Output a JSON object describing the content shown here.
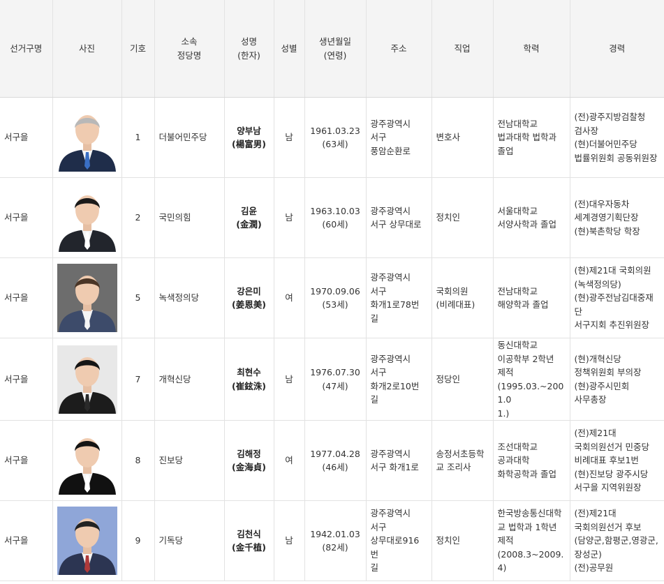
{
  "headers": {
    "district": "선거구명",
    "photo": "사진",
    "number": "기호",
    "party": "소속\n정당명",
    "name": "성명\n(한자)",
    "gender": "성별",
    "birth": "생년월일\n(연령)",
    "address": "주소",
    "job": "직업",
    "education": "학력",
    "career": "경력"
  },
  "rows": [
    {
      "district": "서구을",
      "number": "1",
      "party": "더불어민주당",
      "name": "양부남\n(楊富男)",
      "gender": "남",
      "birth": "1961.03.23\n(63세)",
      "address": "광주광역시\n서구\n풍암순환로",
      "job": "변호사",
      "education": "전남대학교\n법과대학 법학과\n졸업",
      "career": "(전)광주지방검찰청\n검사장\n(현)더불어민주당\n법률위원회 공동위원장",
      "photo_bg": "#ffffff",
      "photo_suit": "#1f2d4a",
      "photo_hair": "#b8b8b8",
      "photo_tie": "#3a6fc4"
    },
    {
      "district": "서구을",
      "number": "2",
      "party": "국민의힘",
      "name": "김윤\n(金潤)",
      "gender": "남",
      "birth": "1963.10.03\n(60세)",
      "address": "광주광역시\n서구 상무대로",
      "job": "정치인",
      "education": "서울대학교\n서양사학과 졸업",
      "career": "(전)대우자동차\n세계경영기획단장\n(현)북촌학당 학장",
      "photo_bg": "#ffffff",
      "photo_suit": "#22252c",
      "photo_hair": "#1a1a1a",
      "photo_tie": "#ffffff"
    },
    {
      "district": "서구을",
      "number": "5",
      "party": "녹색정의당",
      "name": "강은미\n(姜恩美)",
      "gender": "여",
      "birth": "1970.09.06\n(53세)",
      "address": "광주광역시\n서구\n화개1로78번길",
      "job": "국회의원\n(비례대표)",
      "education": "전남대학교\n해양학과 졸업",
      "career": "(현)제21대 국회의원\n(녹색정의당)\n(현)광주전남김대중재단\n서구지회 추진위원장",
      "photo_bg": "#6d6d6d",
      "photo_suit": "#3d4b6a",
      "photo_hair": "#4a3526",
      "photo_tie": "#f5f5f5"
    },
    {
      "district": "서구을",
      "number": "7",
      "party": "개혁신당",
      "name": "최현수\n(崔鉉洙)",
      "gender": "남",
      "birth": "1976.07.30\n(47세)",
      "address": "광주광역시\n서구\n화개2로10번길",
      "job": "정당인",
      "education": "동신대학교\n이공학부 2학년\n제적\n(1995.03.~2001.0\n1.)",
      "career": "(현)개혁신당\n정책위원회 부의장\n(현)광주시민회\n사무총장",
      "photo_bg": "#e8e8e8",
      "photo_suit": "#1c1c1c",
      "photo_hair": "#151515",
      "photo_tie": "#2a2a2a"
    },
    {
      "district": "서구을",
      "number": "8",
      "party": "진보당",
      "name": "김해정\n(金海貞)",
      "gender": "여",
      "birth": "1977.04.28\n(46세)",
      "address": "광주광역시\n서구 화개1로",
      "job": "송정서초등학\n교 조리사",
      "education": "조선대학교\n공과대학\n화학공학과 졸업",
      "career": "(전)제21대\n국회의원선거 민중당\n비례대표 후보1번\n(현)진보당 광주시당\n서구을 지역위원장",
      "photo_bg": "#ffffff",
      "photo_suit": "#111111",
      "photo_hair": "#141414",
      "photo_tie": "#ffffff"
    },
    {
      "district": "서구을",
      "number": "9",
      "party": "기독당",
      "name": "김천식\n(金千植)",
      "gender": "남",
      "birth": "1942.01.03\n(82세)",
      "address": "광주광역시\n서구\n상무대로916번\n길",
      "job": "정치인",
      "education": "한국방송통신대학\n교 법학과 1학년\n제적\n(2008.3~2009.4)",
      "career": "(전)제21대\n국회의원선거 후보\n(담양군,함평군,영광군,\n장성군)\n(전)공무원",
      "photo_bg": "#8fa6d8",
      "photo_suit": "#2c3552",
      "photo_hair": "#222222",
      "photo_tie": "#b03a3a"
    }
  ]
}
